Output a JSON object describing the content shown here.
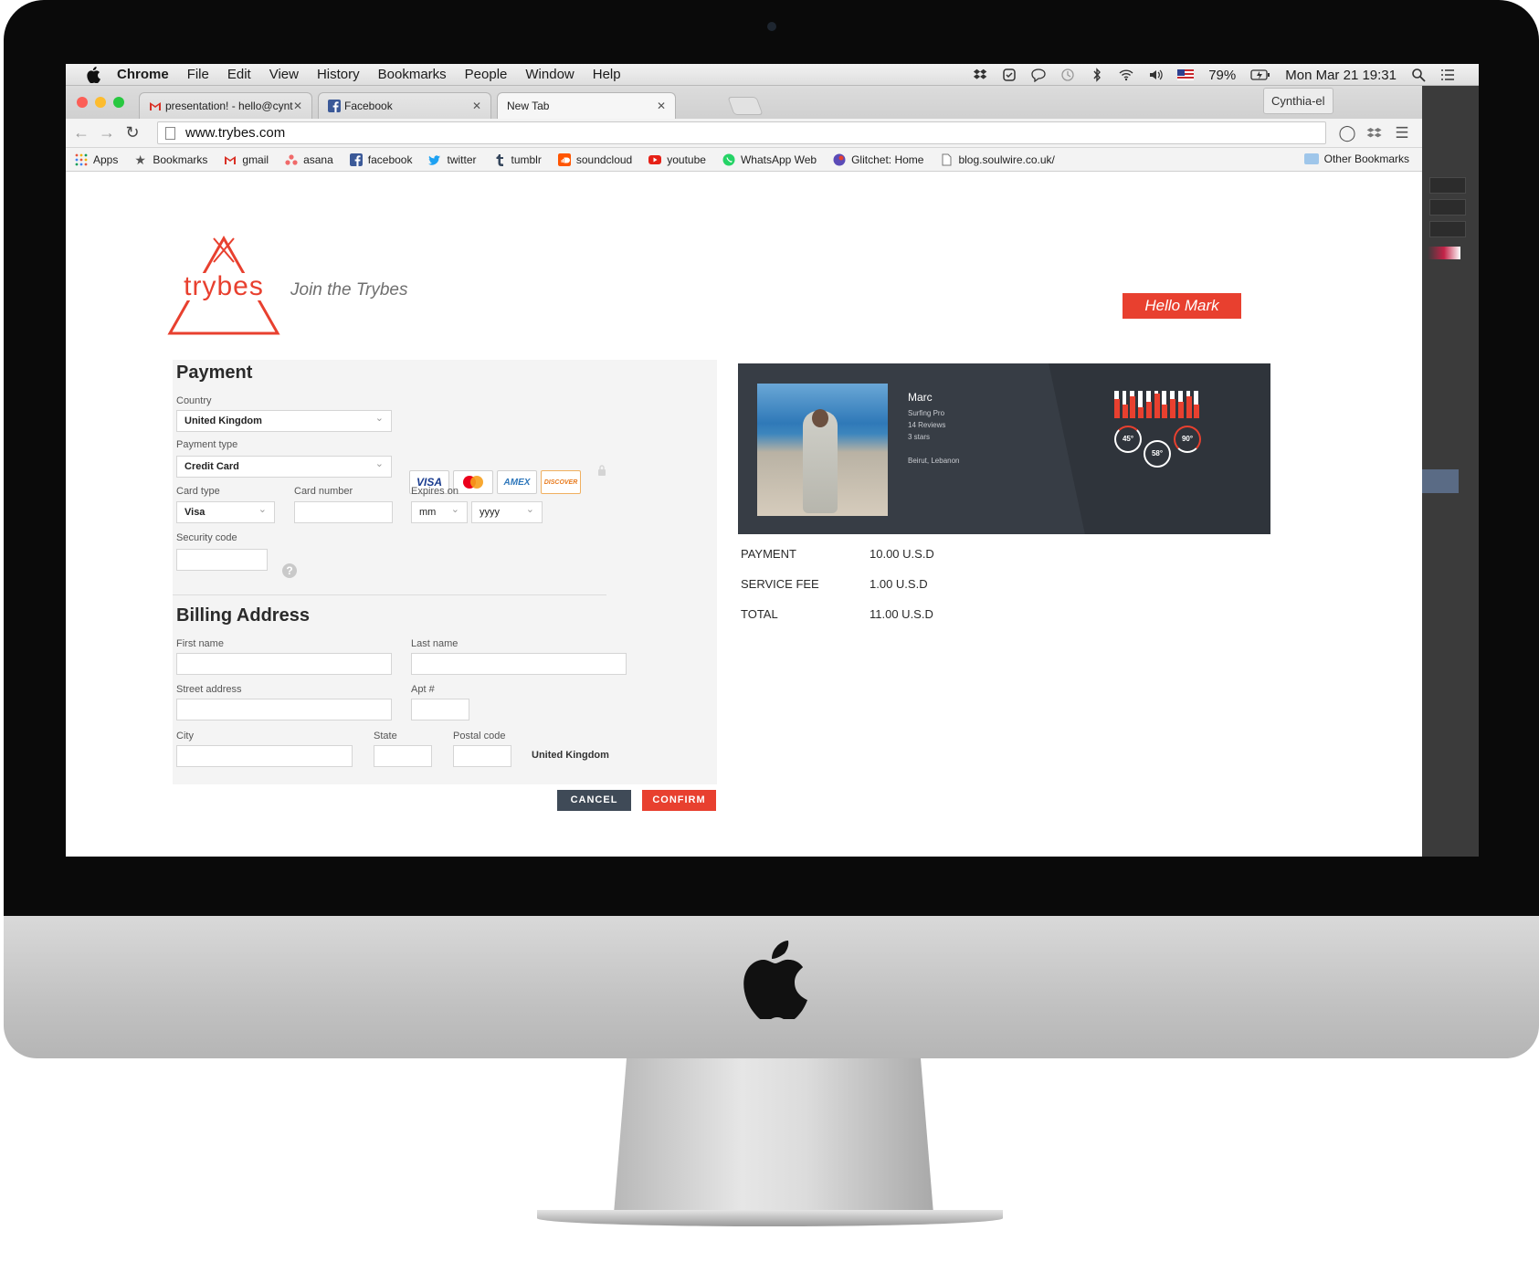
{
  "menubar": {
    "app": "Chrome",
    "items": [
      "File",
      "Edit",
      "View",
      "History",
      "Bookmarks",
      "People",
      "Window",
      "Help"
    ],
    "battery": "79%",
    "clock": "Mon Mar 21  19:31"
  },
  "tabs": [
    {
      "title": "presentation! - hello@cynti",
      "icon": "gmail-icon"
    },
    {
      "title": "Facebook",
      "icon": "facebook-icon"
    },
    {
      "title": "New Tab",
      "icon": ""
    }
  ],
  "profile_name": "Cynthia-el",
  "address": "www.trybes.com",
  "bookmarks": [
    {
      "label": "Apps",
      "icon": "apps-grid-icon",
      "color": "#e6553f"
    },
    {
      "label": "Bookmarks",
      "icon": "star-icon",
      "color": "#555555"
    },
    {
      "label": "gmail",
      "icon": "gmail-icon",
      "color": "#d93025"
    },
    {
      "label": "asana",
      "icon": "asana-icon",
      "color": "#f06a6a"
    },
    {
      "label": "facebook",
      "icon": "facebook-icon",
      "color": "#3b5998"
    },
    {
      "label": "twitter",
      "icon": "twitter-icon",
      "color": "#1da1f2"
    },
    {
      "label": "tumblr",
      "icon": "tumblr-icon",
      "color": "#35465c"
    },
    {
      "label": "soundcloud",
      "icon": "soundcloud-icon",
      "color": "#ff5500"
    },
    {
      "label": "youtube",
      "icon": "youtube-icon",
      "color": "#e62117"
    },
    {
      "label": "WhatsApp Web",
      "icon": "whatsapp-icon",
      "color": "#25d366"
    },
    {
      "label": "Glitchet: Home",
      "icon": "glitchet-icon",
      "color": "#5b4bb7"
    },
    {
      "label": "blog.soulwire.co.uk/",
      "icon": "page-icon",
      "color": "#ffffff"
    }
  ],
  "other_bookmarks": "Other Bookmarks",
  "site": {
    "logo_text": "trybes",
    "tagline": "Join the Trybes",
    "greeting": "Hello Mark",
    "brand_color": "#e8402f"
  },
  "payment": {
    "heading": "Payment",
    "country_label": "Country",
    "country_value": "United Kingdom",
    "payment_type_label": "Payment type",
    "payment_type_value": "Credit Card",
    "cards": [
      "VISA",
      "AMEX",
      "DISCOVER"
    ],
    "card_type_label": "Card type",
    "card_type_value": "Visa",
    "card_number_label": "Card number",
    "card_number_value": "",
    "expires_label": "Expires on",
    "expires_month": "mm",
    "expires_year": "yyyy",
    "security_label": "Security code",
    "security_value": ""
  },
  "billing": {
    "heading": "Billing Address",
    "first_name_label": "First name",
    "last_name_label": "Last name",
    "street_label": "Street address",
    "apt_label": "Apt #",
    "city_label": "City",
    "state_label": "State",
    "postal_label": "Postal code",
    "country_value": "United Kingdom"
  },
  "actions": {
    "cancel": "CANCEL",
    "confirm": "CONFIRM"
  },
  "host_card": {
    "name": "Marc",
    "lines": [
      "Surfing Pro",
      "14 Reviews",
      "3 stars"
    ],
    "location": "Beirut, Lebanon",
    "bar_levels": [
      0.7,
      0.5,
      0.8,
      0.4,
      0.6,
      0.9,
      0.5,
      0.7,
      0.6,
      0.8,
      0.5
    ],
    "rings": [
      "45°",
      "58°",
      "90°"
    ]
  },
  "summary": [
    {
      "label": "PAYMENT",
      "value": "10.00 U.S.D"
    },
    {
      "label": "SERVICE FEE",
      "value": "1.00 U.S.D"
    },
    {
      "label": "TOTAL",
      "value": "11.00 U.S.D"
    }
  ]
}
